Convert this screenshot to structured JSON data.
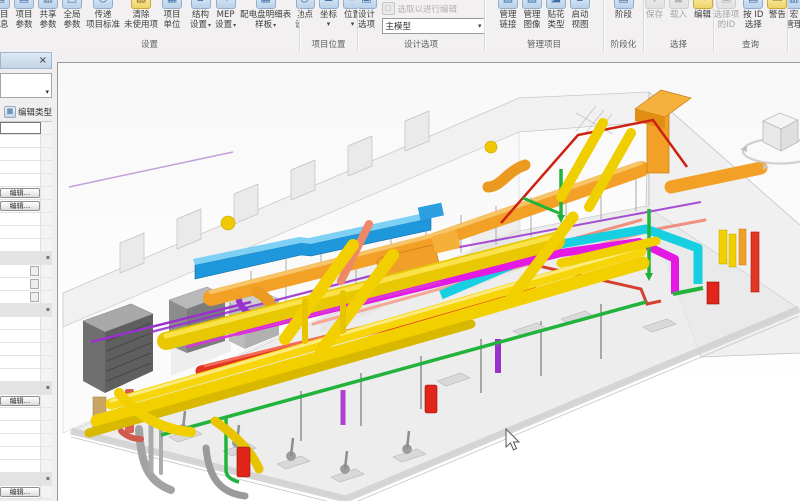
{
  "colors": {
    "duct_yellow": "#f2d000",
    "duct_orange": "#f2a126",
    "duct_blue": "#1f97dd",
    "duct_cyan": "#17cfe0",
    "pipe_magenta": "#e41ae4",
    "pipe_purple": "#9932cc",
    "pipe_red": "#e1251b",
    "pipe_green": "#22b33c",
    "pipe_salmon": "#ef9080",
    "panel_titlebar": "#cfdeee"
  },
  "ribbon": {
    "groups": [
      {
        "name": "settings",
        "label": "设置",
        "items": [
          {
            "name": "project-info",
            "icon": "sheet",
            "l1": "项目",
            "l2": "信息",
            "clip": true
          },
          {
            "name": "project-parameters",
            "icon": "sheet",
            "l1": "项目",
            "l2": "参数"
          },
          {
            "name": "shared-parameters",
            "icon": "sheet2",
            "l1": "共享",
            "l2": "参数"
          },
          {
            "name": "global-parameters",
            "icon": "global",
            "l1": "全局",
            "l2": "参数"
          },
          {
            "name": "transfer-project-standards",
            "icon": "transfer",
            "l1": "传递",
            "l2": "项目标准"
          },
          {
            "name": "purge-unused",
            "icon": "purge",
            "tint": "yellow",
            "l1": "清除",
            "l2": "未使用项"
          },
          {
            "name": "project-units",
            "icon": "units",
            "l1": "项目",
            "l2": "单位",
            "sep_after": true
          },
          {
            "name": "structural-settings",
            "icon": "struct",
            "l1": "结构",
            "l2": "设置",
            "arrow": "inline"
          },
          {
            "name": "mep-settings",
            "icon": "mep",
            "l1": "MEP",
            "l2": "设置",
            "arrow": "inline"
          },
          {
            "name": "panel-schedule-templates",
            "icon": "schedule",
            "l1": "配电盘明细表",
            "l2": "样板",
            "arrow": "inline"
          },
          {
            "name": "additional-settings",
            "icon": "gear",
            "l1": "其他",
            "l2": "设置",
            "arrow": "inline"
          }
        ]
      },
      {
        "name": "project-location",
        "label": "项目位置",
        "items": [
          {
            "name": "location",
            "icon": "globe",
            "l1": "地点"
          },
          {
            "name": "coordinates",
            "icon": "coords",
            "l1": "坐标",
            "arrow": "below"
          },
          {
            "name": "position",
            "icon": "position",
            "l1": "位置",
            "arrow": "below"
          }
        ]
      },
      {
        "name": "design-options",
        "label": "设计选项",
        "items": [
          {
            "name": "design-options",
            "icon": "design",
            "l1": "设计",
            "l2": "选项"
          }
        ],
        "extra": {
          "pick_label": "选取以进行编辑",
          "combo_value": "主模型"
        }
      },
      {
        "name": "manage-project",
        "label": "管理项目",
        "items": [
          {
            "name": "manage-links",
            "icon": "links",
            "l1": "管理",
            "l2": "链接"
          },
          {
            "name": "manage-images",
            "icon": "image",
            "l1": "管理",
            "l2": "图像"
          },
          {
            "name": "decal-types",
            "icon": "decal",
            "l1": "贴花",
            "l2": "类型"
          },
          {
            "name": "starting-view",
            "icon": "startview",
            "l1": "启动",
            "l2": "视图"
          }
        ]
      },
      {
        "name": "phasing",
        "label": "阶段化",
        "items": [
          {
            "name": "phases",
            "icon": "phases",
            "l1": "阶段"
          }
        ]
      },
      {
        "name": "selection",
        "label": "选择",
        "items": [
          {
            "name": "save-selection",
            "icon": "save",
            "l1": "保存",
            "disabled": true
          },
          {
            "name": "load-selection",
            "icon": "load",
            "l1": "载入",
            "disabled": true
          },
          {
            "name": "edit-selection",
            "icon": "edit",
            "tint": "yellow",
            "l1": "编辑"
          }
        ]
      },
      {
        "name": "inquiry",
        "label": "查询",
        "items": [
          {
            "name": "ids-of-selection",
            "icon": "ids",
            "l1": "选择项",
            "l2": "的ID",
            "disabled": true
          },
          {
            "name": "select-by-id",
            "icon": "byid",
            "l1": "按 ID",
            "l2": "选择"
          },
          {
            "name": "warnings",
            "icon": "warning",
            "tint": "yellow",
            "l1": "警告"
          }
        ]
      },
      {
        "name": "macros",
        "label": "",
        "items": [
          {
            "name": "macro-manager",
            "icon": "macro",
            "l1": "宏",
            "l2": "管理"
          }
        ]
      }
    ]
  },
  "properties_panel": {
    "edit_type_label": "编辑类型",
    "edit_button_label": "编辑...",
    "rows": [
      "input",
      "empty",
      "empty",
      "empty",
      "empty",
      "button",
      "button",
      "empty",
      "empty",
      "empty",
      "header",
      "spin",
      "spin",
      "spin",
      "header",
      "empty",
      "empty",
      "empty",
      "empty",
      "empty",
      "header",
      "button",
      "empty",
      "empty",
      "empty",
      "empty",
      "empty",
      "header",
      "button"
    ]
  }
}
